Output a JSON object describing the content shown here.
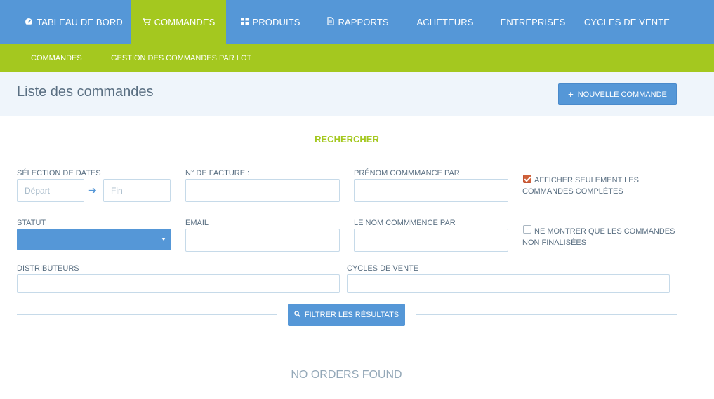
{
  "topnav": {
    "items": [
      {
        "label": "TABLEAU DE BORD",
        "icon": "dashboard-icon"
      },
      {
        "label": "COMMANDES",
        "icon": "cart-icon",
        "active": true
      },
      {
        "label": "PRODUITS",
        "icon": "grid-icon"
      },
      {
        "label": "RAPPORTS",
        "icon": "document-icon"
      },
      {
        "label": "ACHETEURS"
      },
      {
        "label": "ENTREPRISES"
      },
      {
        "label": "CYCLES DE VENTE"
      }
    ]
  },
  "subnav": {
    "items": [
      {
        "label": "COMMANDES",
        "active": true
      },
      {
        "label": "GESTION DES COMMANDES PAR LOT"
      }
    ]
  },
  "header": {
    "title": "Liste des commandes",
    "new_button": "NOUVELLE COMMANDE"
  },
  "search": {
    "title": "RECHERCHER",
    "dates_label": "SÉLECTION DE DATES",
    "start_placeholder": "Départ",
    "end_placeholder": "Fin",
    "invoice_label": "N° DE FACTURE :",
    "firstname_label": "PRÉNOM COMMMANCE PAR",
    "status_label": "STATUT",
    "status_value": "",
    "email_label": "EMAIL",
    "lastname_label": "LE NOM COMMMENCE PAR",
    "distributors_label": "DISTRIBUTEURS",
    "cycles_label": "CYCLES DE VENTE",
    "complete_only": {
      "line1": "AFFICHER SEULEMENT LES",
      "line2": "COMMANDES COMPLÈTES",
      "checked": true
    },
    "unfinished_only": {
      "line1": "NE MONTRER QUE LES COMMANDES",
      "line2": "NON FINALISÉES",
      "checked": false
    },
    "filter_button": "FILTRER LES RÉSULTATS"
  },
  "results": {
    "empty_text": "NO ORDERS FOUND"
  },
  "colors": {
    "primary": "#5597d7",
    "accent": "#a4c81f",
    "checkbox": "#d0613a"
  }
}
